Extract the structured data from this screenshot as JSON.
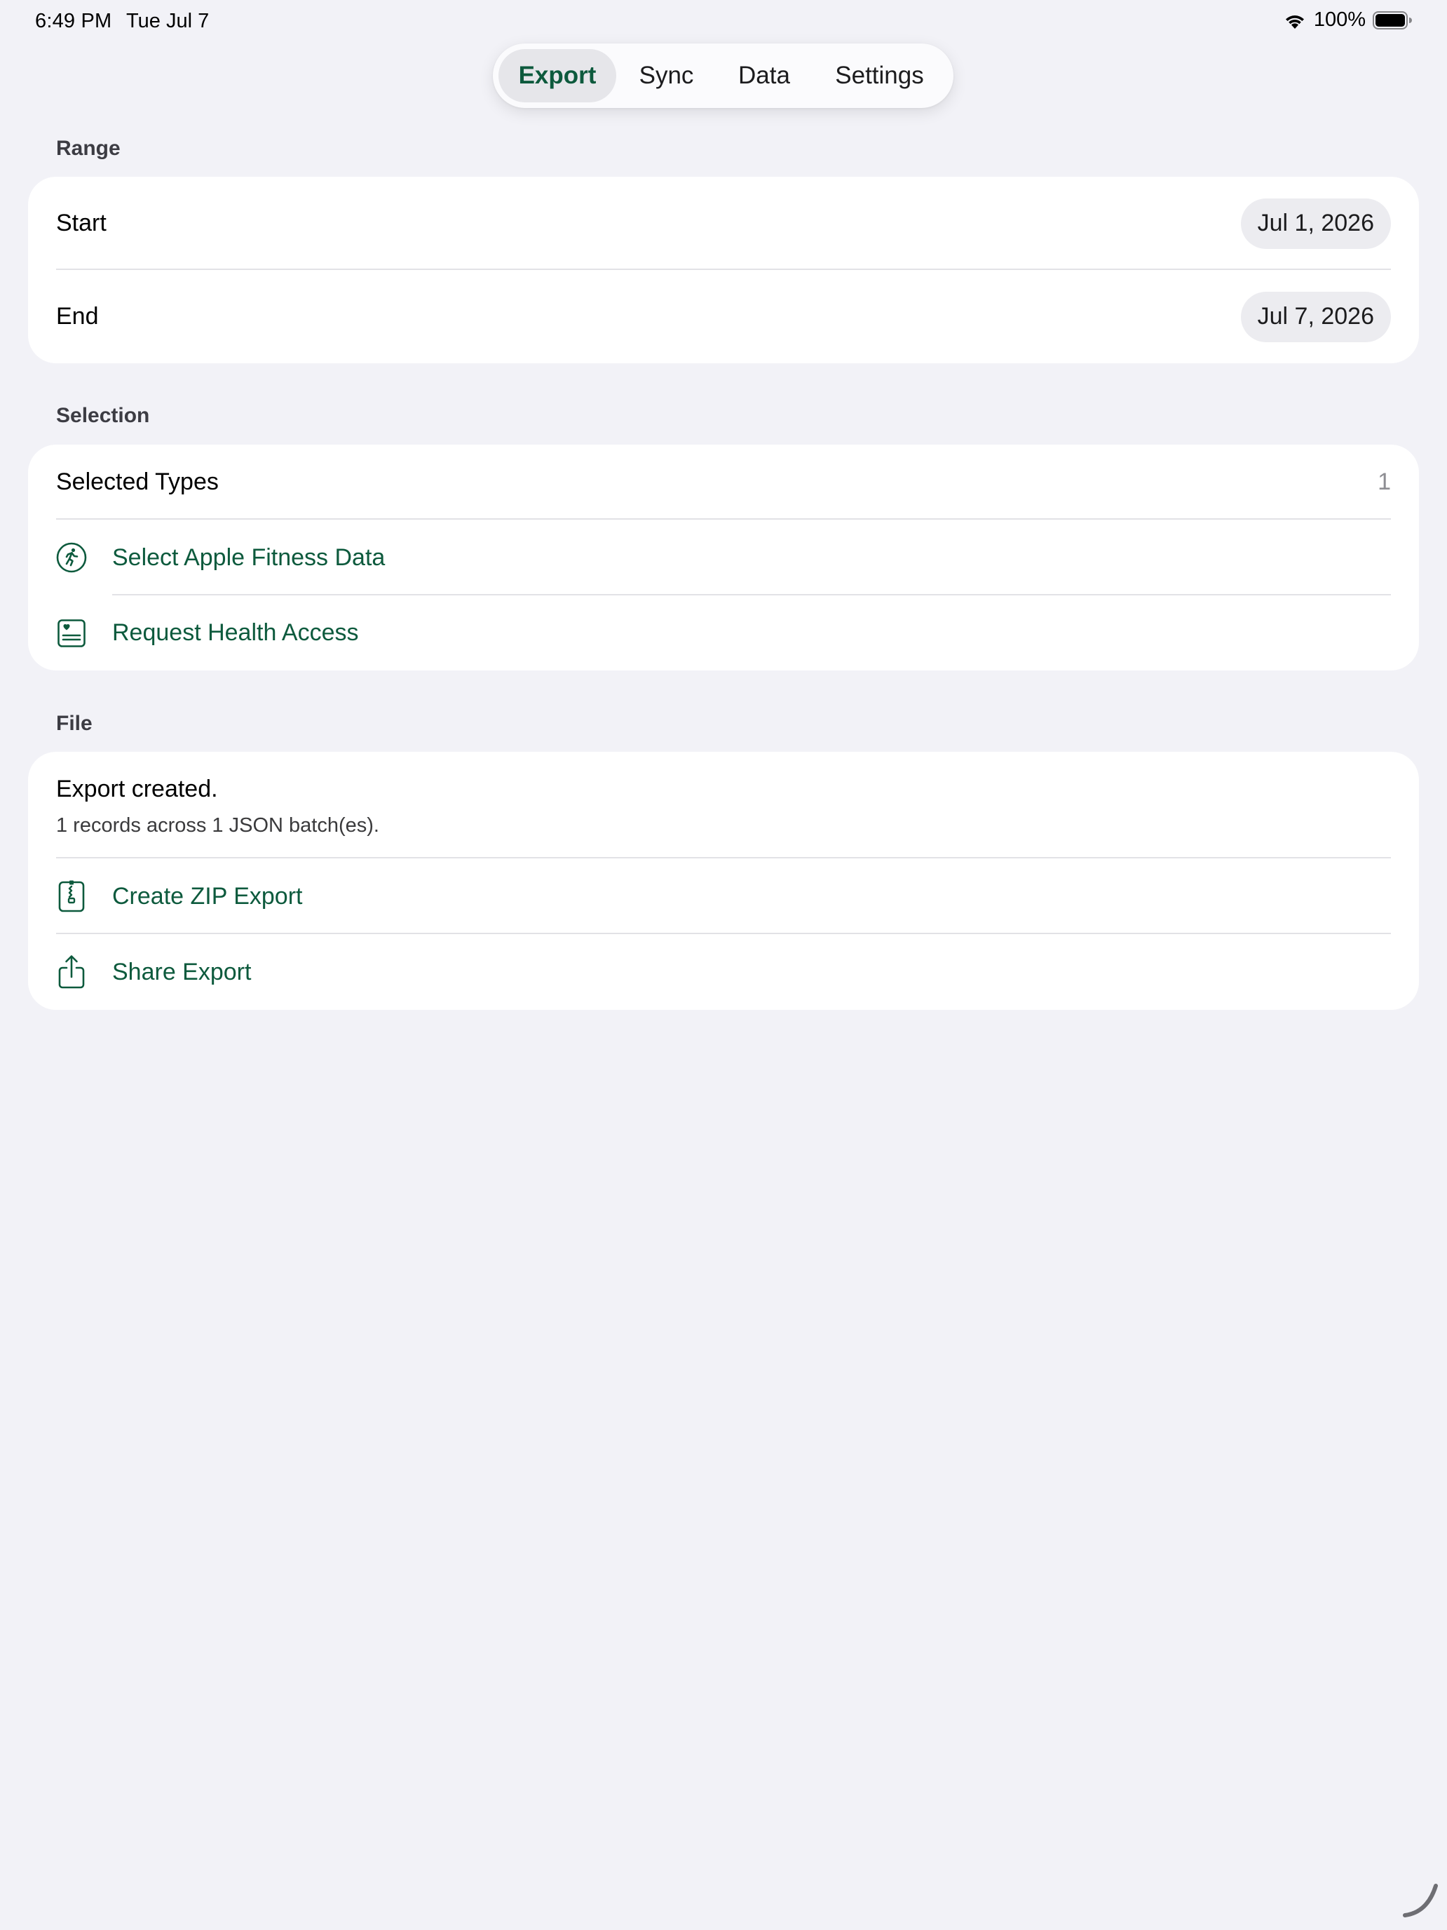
{
  "status_bar": {
    "time": "6:49 PM",
    "date": "Tue Jul 7",
    "battery_percent": "100%"
  },
  "tabs": [
    {
      "label": "Export",
      "active": true
    },
    {
      "label": "Sync",
      "active": false
    },
    {
      "label": "Data",
      "active": false
    },
    {
      "label": "Settings",
      "active": false
    }
  ],
  "range": {
    "header": "Range",
    "start_label": "Start",
    "start_value": "Jul 1, 2026",
    "end_label": "End",
    "end_value": "Jul 7, 2026"
  },
  "selection": {
    "header": "Selection",
    "selected_types_label": "Selected Types",
    "selected_types_count": "1",
    "select_fitness_label": "Select Apple Fitness Data",
    "request_access_label": "Request Health Access"
  },
  "file": {
    "header": "File",
    "status_title": "Export created.",
    "status_detail": "1 records across 1 JSON batch(es).",
    "create_zip_label": "Create ZIP Export",
    "share_label": "Share Export"
  },
  "colors": {
    "accent": "#0d5a3d",
    "background": "#f2f2f7",
    "card": "#ffffff"
  }
}
